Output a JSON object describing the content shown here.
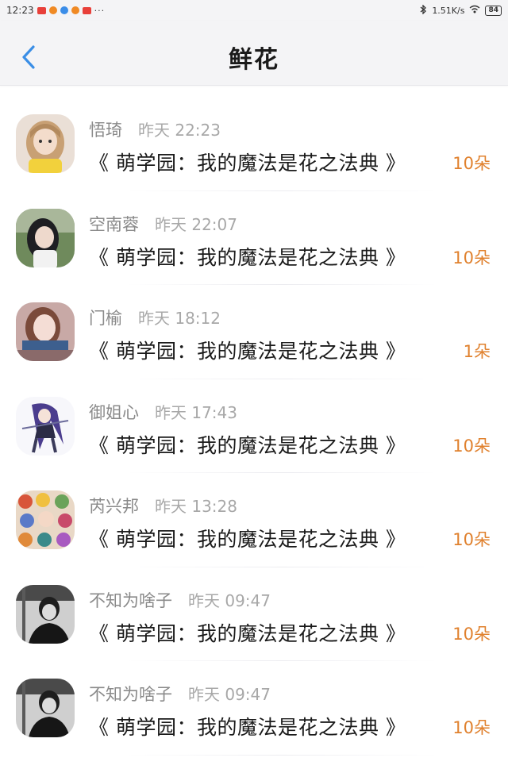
{
  "status_bar": {
    "time": "12:23",
    "dots": "···",
    "network_speed": "1.51K/s",
    "battery": "84"
  },
  "header": {
    "title": "鲜花",
    "back_icon": "chevron-left-icon",
    "accent_color": "#3a8ee6"
  },
  "colors": {
    "count_color": "#e0812e",
    "name_color": "#8a8a8a"
  },
  "items": [
    {
      "name": "悟琦",
      "time": "昨天 22:23",
      "book": "《 萌学园：我的魔法是花之法典 》",
      "count": "10朵",
      "avatar": "girl-blonde-avatar"
    },
    {
      "name": "空南蓉",
      "time": "昨天 22:07",
      "book": "《 萌学园：我的魔法是花之法典 》",
      "count": "10朵",
      "avatar": "girl-dark-hair-avatar"
    },
    {
      "name": "门榆",
      "time": "昨天 18:12",
      "book": "《 萌学园：我的魔法是花之法典 》",
      "count": "1朵",
      "avatar": "girl-portrait-avatar"
    },
    {
      "name": "御姐心",
      "time": "昨天 17:43",
      "book": "《 萌学园：我的魔法是花之法典 》",
      "count": "10朵",
      "avatar": "anime-girl-avatar"
    },
    {
      "name": "芮兴邦",
      "time": "昨天 13:28",
      "book": "《 萌学园：我的魔法是花之法典 》",
      "count": "10朵",
      "avatar": "anime-collage-avatar"
    },
    {
      "name": "不知为啥子",
      "time": "昨天 09:47",
      "book": "《 萌学园：我的魔法是花之法典 》",
      "count": "10朵",
      "avatar": "bw-boy-avatar"
    },
    {
      "name": "不知为啥子",
      "time": "昨天 09:47",
      "book": "《 萌学园：我的魔法是花之法典 》",
      "count": "10朵",
      "avatar": "bw-boy-avatar"
    }
  ]
}
